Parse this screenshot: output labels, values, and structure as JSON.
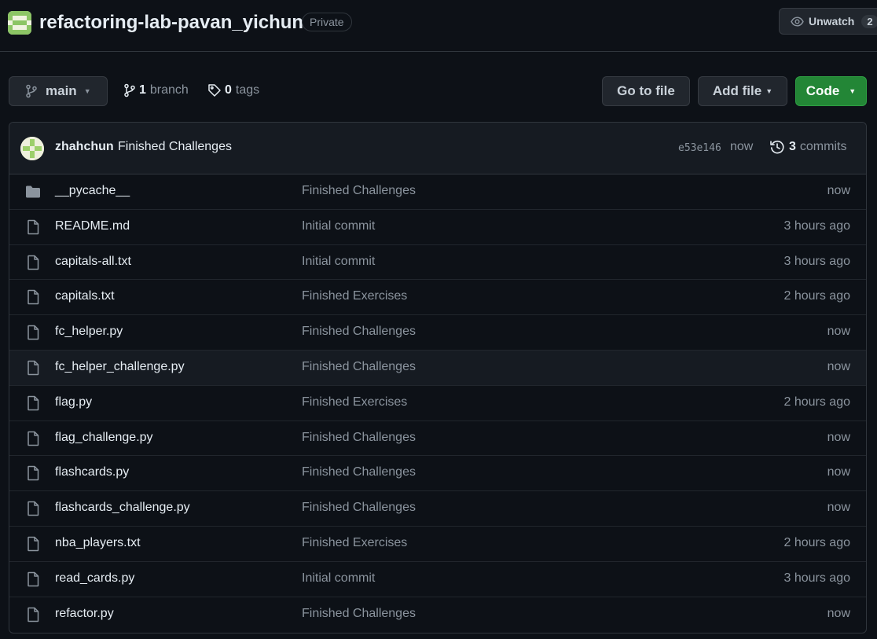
{
  "repo": {
    "name": "refactoring-lab-pavan_yichun",
    "visibility": "Private",
    "watch_label": "Unwatch",
    "watch_count": "2"
  },
  "toolbar": {
    "branch": "main",
    "branch_count": "1",
    "branch_label": "branch",
    "tag_count": "0",
    "tag_label": "tags",
    "go_to_file": "Go to file",
    "add_file": "Add file",
    "code": "Code"
  },
  "latest_commit": {
    "author": "zhahchun",
    "message": "Finished Challenges",
    "sha": "e53e146",
    "time": "now",
    "commit_count": "3",
    "commit_label": "commits"
  },
  "files": [
    {
      "name": "__pycache__",
      "type": "folder",
      "commit": "Finished Challenges",
      "age": "now"
    },
    {
      "name": "README.md",
      "type": "file",
      "commit": "Initial commit",
      "age": "3 hours ago"
    },
    {
      "name": "capitals-all.txt",
      "type": "file",
      "commit": "Initial commit",
      "age": "3 hours ago"
    },
    {
      "name": "capitals.txt",
      "type": "file",
      "commit": "Finished Exercises",
      "age": "2 hours ago"
    },
    {
      "name": "fc_helper.py",
      "type": "file",
      "commit": "Finished Challenges",
      "age": "now"
    },
    {
      "name": "fc_helper_challenge.py",
      "type": "file",
      "commit": "Finished Challenges",
      "age": "now"
    },
    {
      "name": "flag.py",
      "type": "file",
      "commit": "Finished Exercises",
      "age": "2 hours ago"
    },
    {
      "name": "flag_challenge.py",
      "type": "file",
      "commit": "Finished Challenges",
      "age": "now"
    },
    {
      "name": "flashcards.py",
      "type": "file",
      "commit": "Finished Challenges",
      "age": "now"
    },
    {
      "name": "flashcards_challenge.py",
      "type": "file",
      "commit": "Finished Challenges",
      "age": "now"
    },
    {
      "name": "nba_players.txt",
      "type": "file",
      "commit": "Finished Exercises",
      "age": "2 hours ago"
    },
    {
      "name": "read_cards.py",
      "type": "file",
      "commit": "Initial commit",
      "age": "3 hours ago"
    },
    {
      "name": "refactor.py",
      "type": "file",
      "commit": "Finished Challenges",
      "age": "now"
    }
  ],
  "colors": {
    "background": "#0d1117",
    "border": "#30363d",
    "primary_button": "#238636",
    "muted_text": "#8b949e"
  }
}
